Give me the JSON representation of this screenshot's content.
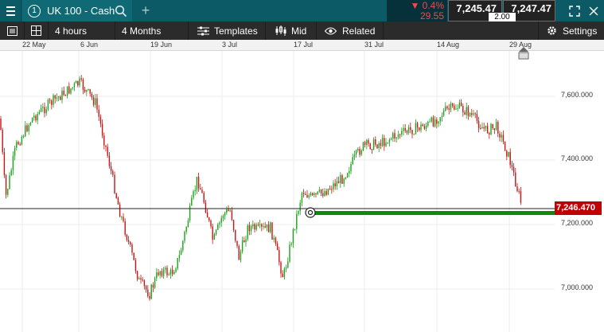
{
  "header": {
    "tab_number": "1",
    "instrument": "UK 100 - Cash",
    "change_percent": "▼ 0.4%",
    "change_points": "29.55",
    "sell_price": "7,245.47",
    "buy_price": "7,247.47",
    "spread": "2.00",
    "icons": {
      "menu": "hamburger-icon",
      "search": "search-icon",
      "add": "plus-icon",
      "expand": "expand-icon",
      "close": "close-icon"
    }
  },
  "toolbar": {
    "interval_label": "4 hours",
    "period_label": "4 Months",
    "templates_label": "Templates",
    "price_type_label": "Mid",
    "related_label": "Related",
    "settings_label": "Settings"
  },
  "date_axis": {
    "labels": [
      "22 May",
      "6 Jun",
      "19 Jun",
      "3 Jul",
      "17 Jul",
      "31 Jul",
      "14 Aug",
      "29 Aug"
    ]
  },
  "price_axis": {
    "labels": [
      "7,600.000",
      "7,400.000",
      "7,200.000",
      "7,000.000"
    ],
    "current_price_tag": "7,246.470"
  },
  "colors": {
    "header_bg": "#0c5a66",
    "toolbar_bg": "#2b2b2b",
    "candle_up": "#1aa31a",
    "candle_down": "#c81414",
    "price_tag_bg": "#c00000",
    "position_line": "#0f8a0f",
    "change_down": "#ee4b4b"
  }
}
